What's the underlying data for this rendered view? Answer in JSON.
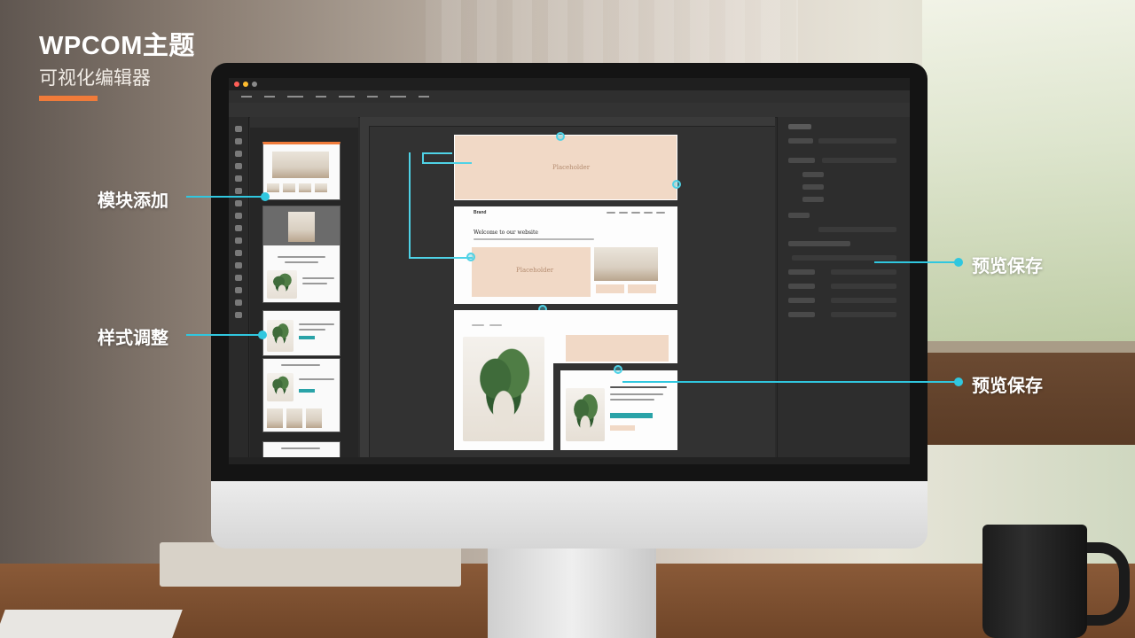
{
  "brand": {
    "title": "WPCOM主题",
    "subtitle": "可视化编辑器",
    "accent_color": "#f07b3a"
  },
  "callouts": {
    "add_module": "模块添加",
    "adjust_style": "样式调整",
    "preview_save_1": "预览保存",
    "preview_save_2": "预览保存",
    "line_color": "#30c7df"
  },
  "editor": {
    "placeholder_label": "Placeholder",
    "section_heading": "Welcome to our website",
    "logo_text": "Brand"
  }
}
